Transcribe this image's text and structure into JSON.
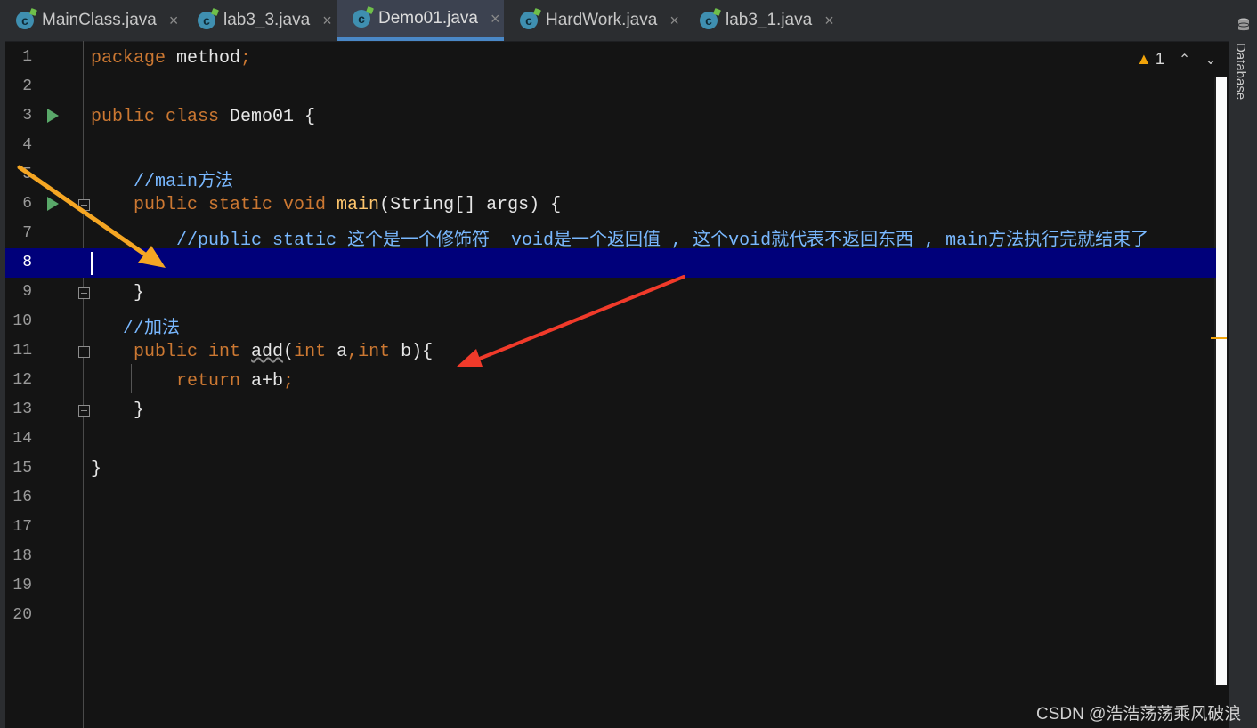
{
  "tabs": [
    {
      "label": "MainClass.java",
      "icon": "java-class-icon",
      "active": false
    },
    {
      "label": "lab3_3.java",
      "icon": "java-class-icon",
      "active": false
    },
    {
      "label": "Demo01.java",
      "icon": "java-class-icon",
      "active": true
    },
    {
      "label": "HardWork.java",
      "icon": "java-class-icon",
      "active": false
    },
    {
      "label": "lab3_1.java",
      "icon": "java-class-icon",
      "active": false
    }
  ],
  "tab_close_glyph": "×",
  "sidebar": {
    "database_label": "Database"
  },
  "inspection": {
    "warning_count": "1",
    "prev_glyph": "⌃",
    "next_glyph": "⌄"
  },
  "lines": [
    {
      "n": "1",
      "tokens": [
        {
          "t": "package ",
          "c": "kw"
        },
        {
          "t": "method",
          "c": ""
        },
        {
          "t": ";",
          "c": "kw"
        }
      ]
    },
    {
      "n": "2",
      "tokens": []
    },
    {
      "n": "3",
      "run": true,
      "tokens": [
        {
          "t": "public class ",
          "c": "kw"
        },
        {
          "t": "Demo01 {",
          "c": ""
        }
      ]
    },
    {
      "n": "4",
      "tokens": []
    },
    {
      "n": "5",
      "tokens": [
        {
          "t": "    //main方法",
          "c": "cm"
        }
      ]
    },
    {
      "n": "6",
      "run": true,
      "fold": true,
      "tokens": [
        {
          "t": "    public static void ",
          "c": "kw"
        },
        {
          "t": "main",
          "c": "fn"
        },
        {
          "t": "(String[] args) {",
          "c": ""
        }
      ]
    },
    {
      "n": "7",
      "tokens": [
        {
          "t": "        //public static 这个是一个修饰符  void是一个返回值 , 这个void就代表不返回东西 , main方法执行完就结束了",
          "c": "cm"
        }
      ]
    },
    {
      "n": "8",
      "current": true,
      "tokens": []
    },
    {
      "n": "9",
      "fold": true,
      "tokens": [
        {
          "t": "    }",
          "c": ""
        }
      ]
    },
    {
      "n": "10",
      "tokens": [
        {
          "t": "   //加法",
          "c": "cm"
        }
      ]
    },
    {
      "n": "11",
      "fold": true,
      "tokens": [
        {
          "t": "    public int ",
          "c": "kw"
        },
        {
          "t": "add",
          "c": "squig"
        },
        {
          "t": "(",
          "c": ""
        },
        {
          "t": "int ",
          "c": "kw"
        },
        {
          "t": "a",
          "c": ""
        },
        {
          "t": ",",
          "c": "kw"
        },
        {
          "t": "int ",
          "c": "kw"
        },
        {
          "t": "b){",
          "c": ""
        }
      ]
    },
    {
      "n": "12",
      "tokens": [
        {
          "t": "        return ",
          "c": "kw"
        },
        {
          "t": "a+b",
          "c": ""
        },
        {
          "t": ";",
          "c": "kw"
        }
      ]
    },
    {
      "n": "13",
      "fold": true,
      "tokens": [
        {
          "t": "    }",
          "c": ""
        }
      ]
    },
    {
      "n": "14",
      "tokens": []
    },
    {
      "n": "15",
      "tokens": [
        {
          "t": "}",
          "c": ""
        }
      ]
    },
    {
      "n": "16",
      "tokens": []
    },
    {
      "n": "17",
      "tokens": []
    },
    {
      "n": "18",
      "tokens": []
    },
    {
      "n": "19",
      "tokens": []
    },
    {
      "n": "20",
      "tokens": []
    }
  ],
  "annotations": [
    {
      "name": "yellow-arrow",
      "color": "#f5a623"
    },
    {
      "name": "red-arrow",
      "color": "#f03a2a"
    }
  ],
  "watermark": "CSDN @浩浩荡荡乘风破浪"
}
